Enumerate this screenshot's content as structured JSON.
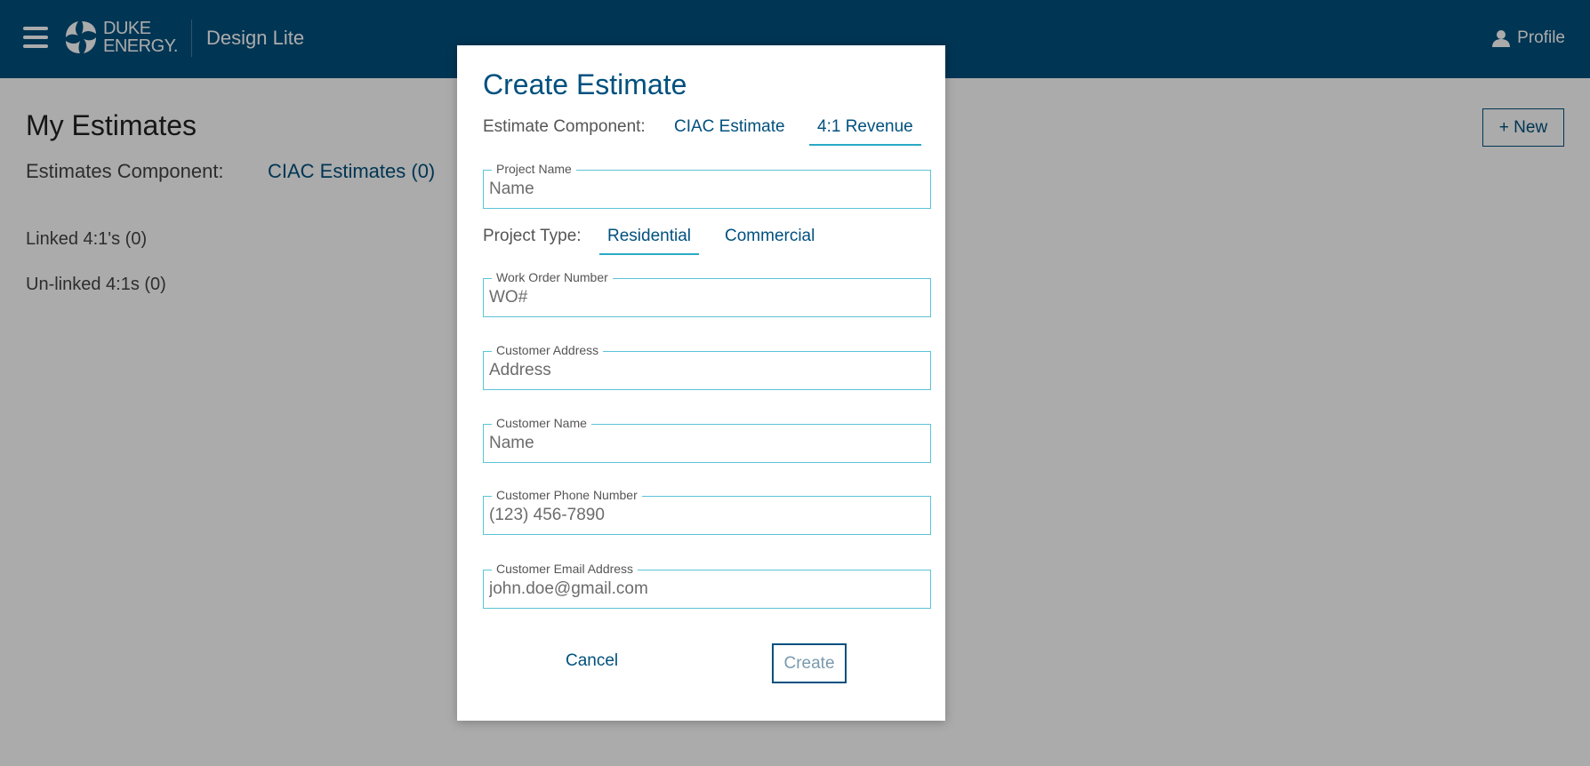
{
  "header": {
    "logo_line1": "DUKE",
    "logo_line2": "ENERGY.",
    "app_title": "Design Lite",
    "profile_label": "Profile",
    "bg_color": "#00507e"
  },
  "page": {
    "title": "My Estimates",
    "component_label": "Estimates Component:",
    "component_link": "CIAC Estimates (0)",
    "linked": "Linked 4:1's (0)",
    "unlinked": "Un-linked 4:1s (0)",
    "new_button": "+ New"
  },
  "modal": {
    "title": "Create Estimate",
    "estimate_component_label": "Estimate Component:",
    "tabs": [
      {
        "label": "CIAC Estimate",
        "active": false
      },
      {
        "label": "4:1 Revenue",
        "active": true
      }
    ],
    "project_type_label": "Project Type:",
    "project_types": [
      {
        "label": "Residential",
        "active": true
      },
      {
        "label": "Commercial",
        "active": false
      }
    ],
    "fields": {
      "project_name": {
        "label": "Project Name",
        "placeholder": "Name",
        "value": ""
      },
      "work_order": {
        "label": "Work Order Number",
        "placeholder": "WO#",
        "value": ""
      },
      "customer_address": {
        "label": "Customer Address",
        "placeholder": "Address",
        "value": ""
      },
      "customer_name": {
        "label": "Customer Name",
        "placeholder": "Name",
        "value": ""
      },
      "customer_phone": {
        "label": "Customer Phone Number",
        "placeholder": "(123) 456-7890",
        "value": ""
      },
      "customer_email": {
        "label": "Customer Email Address",
        "placeholder": "john.doe@gmail.com",
        "value": ""
      }
    },
    "cancel_label": "Cancel",
    "create_label": "Create",
    "accent_color": "#2aa9c5"
  }
}
